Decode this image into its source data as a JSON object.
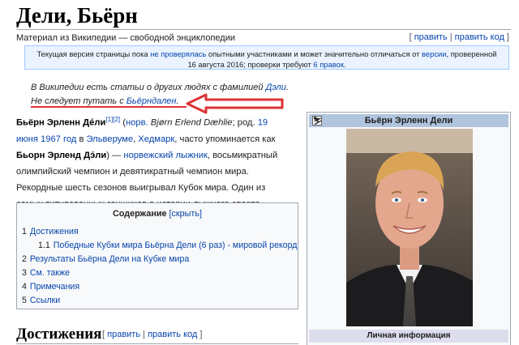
{
  "page": {
    "title": "Дели, Бьёрн",
    "from": "Материал из Википедии — свободной энциклопедии",
    "edit": "править",
    "edit_code": "править код"
  },
  "flagged": {
    "t1": "Текущая версия страницы пока ",
    "link1": "не проверялась",
    "t2": " опытными участниками и может значительно отличаться от ",
    "link2": "версии",
    "t3": ", проверенной 16 августа 2016; проверки требуют ",
    "link3": "6 правок",
    "t4": "."
  },
  "hatnote": {
    "t1": "В Википедии есть статьи о других людях с фамилией ",
    "link1": "Дэли",
    "t2": ".",
    "t3": "Не следует путать с ",
    "link2": "Бьёрндален",
    "t4": "."
  },
  "lead": {
    "name": "Бьёрн Эрленн Дéли",
    "refs": "[1][2]",
    "p1": " (",
    "norw": "норв.",
    "native": " Bjørn Erlend Dæhlie",
    "p2": "; род. ",
    "date": "19 июня",
    "year": "1967 год",
    "p3": " в ",
    "town": "Эльверуме",
    "p4": ", ",
    "county": "Хедмарк",
    "p5": ", часто упоминается как ",
    "alt": "Бьорн Эрленд Дэ́ли",
    "p6": ") — ",
    "skier": "норвежский лыжник",
    "p7": ", восьмикратный олимпийский чемпион и девятикратный чемпион мира. Рекордные шесть сезонов выигрывал Кубок мира. Один из самых титулованных гонщиков в истории лыжного спорта."
  },
  "toc": {
    "title": "Содержание",
    "toggle": "[скрыть]",
    "items": [
      {
        "num": "1",
        "label": "Достижения"
      },
      {
        "num": "1.1",
        "label": "Победные Кубки мира Бьёрна Дели (6 раз) - мировой рекорд"
      },
      {
        "num": "2",
        "label": "Результаты Бьёрна Дели на Кубке мира"
      },
      {
        "num": "3",
        "label": "См. также"
      },
      {
        "num": "4",
        "label": "Примечания"
      },
      {
        "num": "5",
        "label": "Ссылки"
      }
    ]
  },
  "section": {
    "heading": "Достижения",
    "edit": "править",
    "edit_code": "править код"
  },
  "infobox": {
    "title": "Бьёрн Эрленн Дели",
    "icon": "skier-icon",
    "personal_label": "Личная информация"
  },
  "colors": {
    "link": "#0645ad",
    "annotation_red": "#dd3333",
    "infobox_head": "#b0c4de"
  }
}
